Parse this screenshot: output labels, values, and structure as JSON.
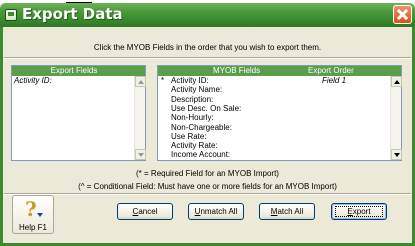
{
  "window": {
    "title": "Export Data"
  },
  "instruction": "Click the MYOB Fields in the order that you wish to export them.",
  "export_fields": {
    "header": "Export Fields",
    "items": [
      "Activity ID:"
    ]
  },
  "myob_fields": {
    "header_field": "MYOB Fields",
    "header_order": "Export Order",
    "rows": [
      {
        "mark": "*",
        "label": "Activity ID:",
        "order": "Field 1"
      },
      {
        "mark": "",
        "label": "Activity Name:",
        "order": ""
      },
      {
        "mark": "",
        "label": "Description:",
        "order": ""
      },
      {
        "mark": "",
        "label": "Use Desc. On Sale:",
        "order": ""
      },
      {
        "mark": "",
        "label": "Non-Hourly:",
        "order": ""
      },
      {
        "mark": "",
        "label": "Non-Chargeable:",
        "order": ""
      },
      {
        "mark": "",
        "label": "Use Rate:",
        "order": ""
      },
      {
        "mark": "",
        "label": "Activity Rate:",
        "order": ""
      },
      {
        "mark": "",
        "label": "Income Account:",
        "order": ""
      }
    ]
  },
  "notes": {
    "required": "(* = Required Field for an MYOB Import)",
    "conditional": "(^ = Conditional Field: Must have one or more fields for an MYOB Import)"
  },
  "buttons": {
    "cancel": {
      "accel": "C",
      "rest": "ancel"
    },
    "unmatch_all": {
      "accel": "U",
      "rest": "nmatch All"
    },
    "match_all": {
      "accel": "M",
      "rest": "atch All"
    },
    "export": {
      "accel": "E",
      "rest": "xport"
    }
  },
  "help": {
    "label": "Help F1"
  },
  "colors": {
    "title_green": "#3b8a2d",
    "header_green": "#5a9d4a",
    "close_orange": "#d8501c"
  }
}
